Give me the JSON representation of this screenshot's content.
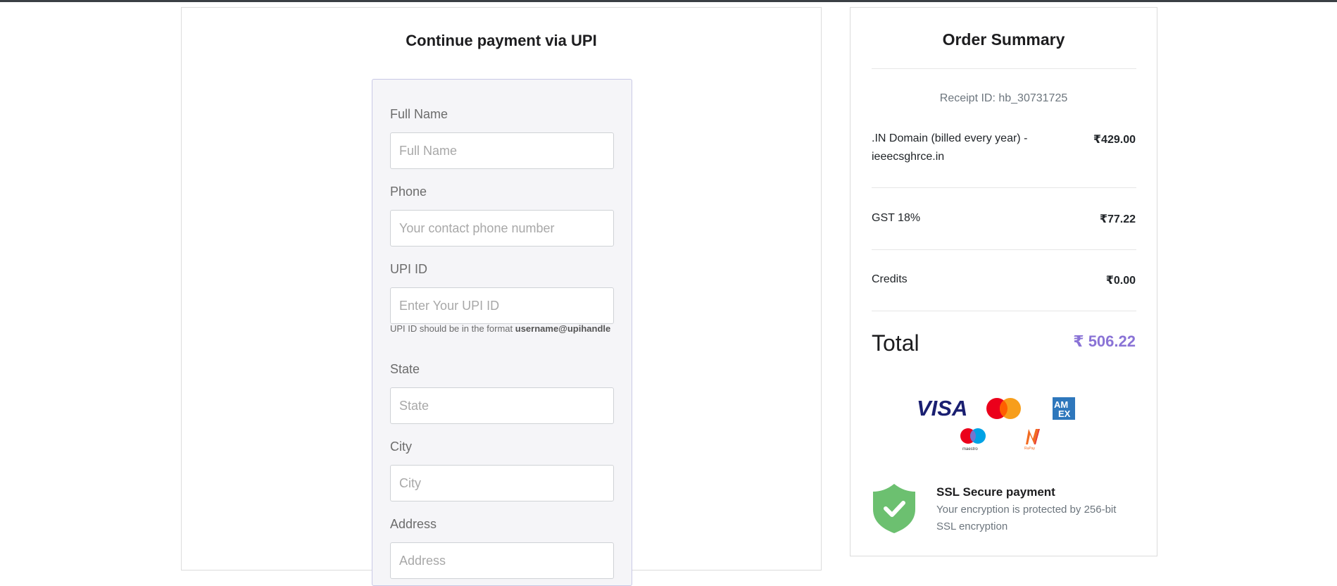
{
  "payment_form": {
    "title": "Continue payment via UPI",
    "full_name": {
      "label": "Full Name",
      "placeholder": "Full Name",
      "value": ""
    },
    "phone": {
      "label": "Phone",
      "placeholder": "Your contact phone number",
      "value": ""
    },
    "upi_id": {
      "label": "UPI ID",
      "placeholder": "Enter Your UPI ID",
      "value": "",
      "hint_prefix": "UPI ID should be in the format ",
      "hint_format": "username@upihandle"
    },
    "state": {
      "label": "State",
      "placeholder": "State",
      "value": ""
    },
    "city": {
      "label": "City",
      "placeholder": "City",
      "value": ""
    },
    "address": {
      "label": "Address",
      "placeholder": "Address",
      "value": ""
    }
  },
  "order_summary": {
    "title": "Order Summary",
    "receipt": "Receipt ID: hb_30731725",
    "items": [
      {
        "label": ".IN Domain (billed every year) - ieeecsghrce.in",
        "value": "₹429.00"
      },
      {
        "label": "GST 18%",
        "value": "₹77.22"
      },
      {
        "label": "Credits",
        "value": "₹0.00"
      }
    ],
    "total_label": "Total",
    "total_value": "₹ 506.22",
    "payment_icons": [
      "visa-icon",
      "mastercard-icon",
      "amex-icon",
      "maestro-icon",
      "rupay-icon"
    ],
    "ssl": {
      "title": "SSL Secure payment",
      "text": "Your encryption is protected by 256-bit SSL encryption"
    }
  },
  "colors": {
    "accent_total": "#8a73d6",
    "form_bg": "#f5f5f8",
    "shield": "#6cc070",
    "visa": "#1a1f71",
    "amex": "#2e77bc"
  }
}
